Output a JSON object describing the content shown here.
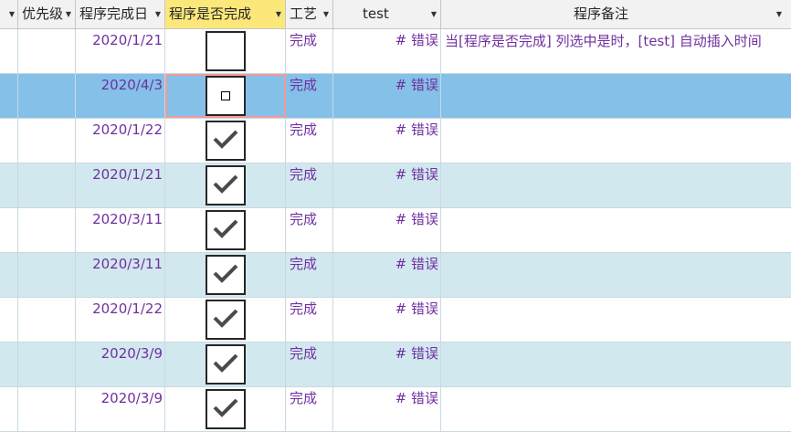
{
  "columns": [
    {
      "label": ""
    },
    {
      "label": "优先级"
    },
    {
      "label": "程序完成日"
    },
    {
      "label": "程序是否完成"
    },
    {
      "label": "工艺"
    },
    {
      "label": "test"
    },
    {
      "label": "程序备注"
    }
  ],
  "rows": [
    {
      "date": "2020/1/21",
      "done": false,
      "process": "完成",
      "test": "# 错误",
      "note": "当[程序是否完成] 列选中是时，[test] 自动插入时间",
      "style": "odd"
    },
    {
      "date": "2020/4/3",
      "done": null,
      "process": "完成",
      "test": "# 错误",
      "note": "",
      "style": "selected"
    },
    {
      "date": "2020/1/22",
      "done": true,
      "process": "完成",
      "test": "# 错误",
      "note": "",
      "style": "odd"
    },
    {
      "date": "2020/1/21",
      "done": true,
      "process": "完成",
      "test": "# 错误",
      "note": "",
      "style": "even"
    },
    {
      "date": "2020/3/11",
      "done": true,
      "process": "完成",
      "test": "# 错误",
      "note": "",
      "style": "odd"
    },
    {
      "date": "2020/3/11",
      "done": true,
      "process": "完成",
      "test": "# 错误",
      "note": "",
      "style": "even"
    },
    {
      "date": "2020/1/22",
      "done": true,
      "process": "完成",
      "test": "# 错误",
      "note": "",
      "style": "odd"
    },
    {
      "date": "2020/3/9",
      "done": true,
      "process": "完成",
      "test": "# 错误",
      "note": "",
      "style": "even"
    },
    {
      "date": "2020/3/9",
      "done": true,
      "process": "完成",
      "test": "# 错误",
      "note": "",
      "style": "odd"
    }
  ],
  "colors": {
    "text": "#7030a0",
    "header_active": "#fce87a",
    "row_alt": "#d2e8ef",
    "row_selected": "#84c0e7"
  },
  "icons": {
    "dropdown": "dropdown-arrow-icon",
    "check": "checkmark-icon"
  }
}
